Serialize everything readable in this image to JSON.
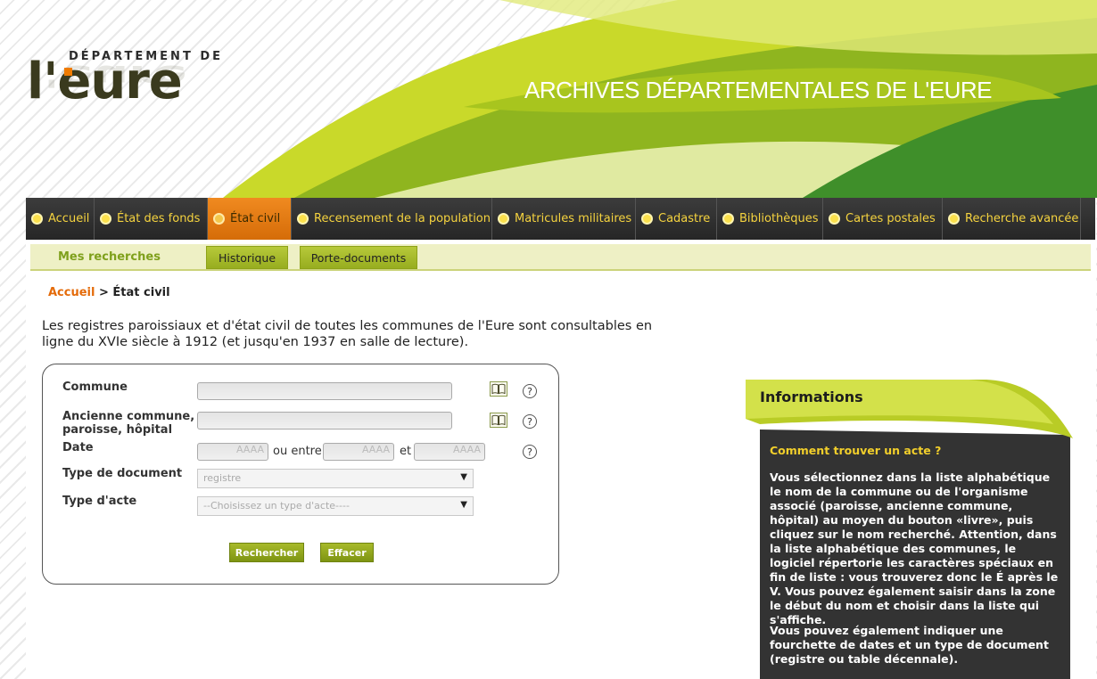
{
  "header": {
    "logo_top": "DÉPARTEMENT DE",
    "logo_main": "l'eure",
    "site_title": "ARCHIVES DÉPARTEMENTALES DE L'EURE"
  },
  "nav": {
    "items": [
      {
        "label": "Accueil",
        "active": false
      },
      {
        "label": "État des fonds",
        "active": false
      },
      {
        "label": "État civil",
        "active": true
      },
      {
        "label": "Recensement de la population",
        "active": false
      },
      {
        "label": "Matricules militaires",
        "active": false
      },
      {
        "label": "Cadastre",
        "active": false
      },
      {
        "label": "Bibliothèques",
        "active": false
      },
      {
        "label": "Cartes postales",
        "active": false
      },
      {
        "label": "Recherche avancée",
        "active": false
      }
    ]
  },
  "subnav": {
    "title": "Mes recherches",
    "historique": "Historique",
    "porte_documents": "Porte-documents"
  },
  "breadcrumb": {
    "home": "Accueil",
    "separator": " > ",
    "current": "État civil"
  },
  "intro": "Les registres paroissiaux et d'état civil de toutes les communes de l'Eure sont consultables en ligne du XVIe siècle à 1912 (et jusqu'en 1937 en salle de lecture).",
  "form": {
    "commune_label": "Commune",
    "ancienne_label": "Ancienne commune, paroisse, hôpital",
    "date_label": "Date",
    "date_from_placeholder": "AAAA",
    "ou_entre": "ou entre",
    "date_start_placeholder": "AAAA",
    "et": "et",
    "date_end_placeholder": "AAAA",
    "type_document_label": "Type de document",
    "type_document_value": "registre",
    "type_acte_label": "Type d'acte",
    "type_acte_value": "--Choisissez un type d'acte----",
    "help": "?",
    "search_button": "Rechercher",
    "clear_button": "Effacer"
  },
  "info": {
    "title": "Informations",
    "subtitle": "Comment trouver un acte ?",
    "paragraph1": "Vous sélectionnez dans la liste alphabétique le nom de la commune ou de l'organisme associé (paroisse, ancienne commune, hôpital) au moyen du bouton «livre», puis cliquez sur le nom recherché. Attention, dans la liste alphabétique des communes, le logiciel répertorie les caractères spéciaux en fin de liste : vous trouverez donc le É après le V. Vous pouvez également saisir dans la zone le début du nom et choisir dans la liste qui s'affiche.",
    "paragraph2": "Vous pouvez également indiquer une fourchette de dates et un type de document (registre ou table décennale)."
  },
  "colors": {
    "nav_text": "#f5d33f",
    "active_tab": "#e07a12",
    "breadcrumb_link": "#e46b0a",
    "accent_green": "#b9cc26",
    "info_bg": "#333333",
    "info_subtitle": "#f2cf2b"
  }
}
